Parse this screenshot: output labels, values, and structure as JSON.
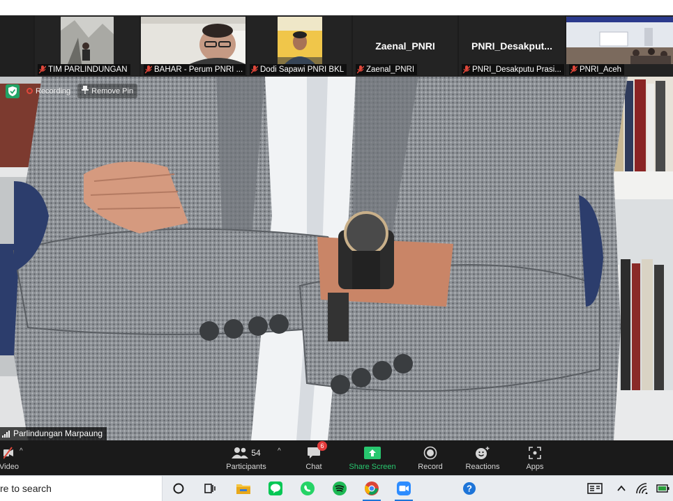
{
  "thumbnails": [
    {
      "name": "TIM PARLINDUNGAN",
      "has_video": true
    },
    {
      "name": "BAHAR - Perum PNRI ...",
      "has_video": true
    },
    {
      "name": "Dodi Sapawi PNRI BKL",
      "has_video": true
    },
    {
      "name": "Zaenal_PNRI",
      "display_name": "Zaenal_PNRI",
      "has_video": false
    },
    {
      "name": "PNRI_Desakputu Prasi...",
      "display_name": "PNRI_Desakput...",
      "has_video": false
    },
    {
      "name": "PNRI_Aceh",
      "has_video": true
    }
  ],
  "overlay": {
    "recording_label": "Recording",
    "remove_pin_label": "Remove Pin"
  },
  "active_speaker": "Parlindungan Marpaung",
  "toolbar": {
    "video_label": "Video",
    "participants_label": "Participants",
    "participants_count": "54",
    "chat_label": "Chat",
    "chat_badge": "6",
    "share_label": "Share Screen",
    "record_label": "Record",
    "reactions_label": "Reactions",
    "apps_label": "Apps"
  },
  "taskbar": {
    "search_text": "re to search",
    "apps": [
      "cortana-icon",
      "task-view-icon",
      "file-explorer-icon",
      "line-icon",
      "whatsapp-icon",
      "spotify-icon",
      "chrome-icon",
      "zoom-icon",
      "help-icon"
    ],
    "tray": [
      "notification-center-icon",
      "chevron-up-icon",
      "network-icon",
      "battery-icon"
    ]
  },
  "colors": {
    "share_green": "#28c76f",
    "badge_red": "#e33b3b",
    "mute_red": "#e0473a",
    "zoom_blue": "#2d8cff"
  }
}
